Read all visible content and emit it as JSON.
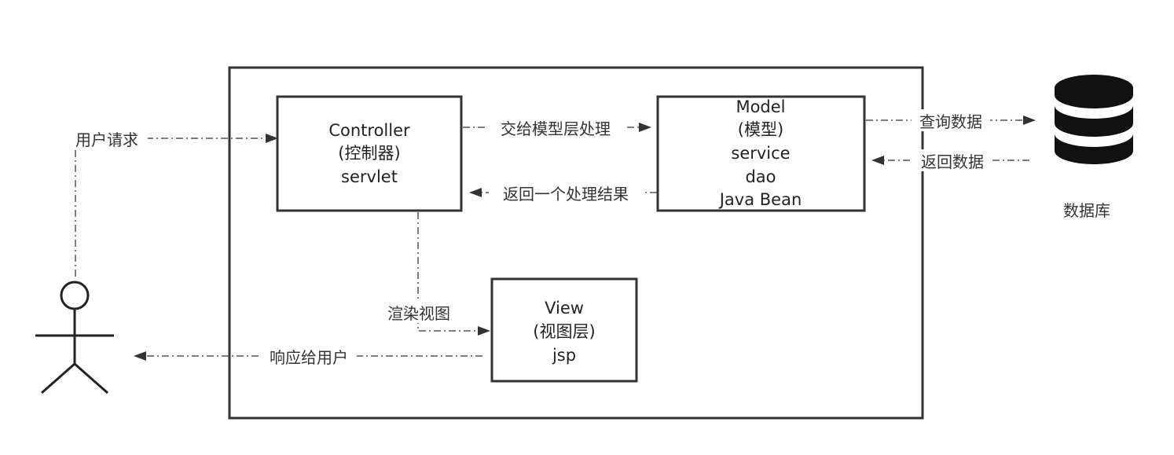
{
  "nodes": {
    "controller": {
      "lines": [
        "Controller",
        "(控制器)",
        "servlet"
      ]
    },
    "model": {
      "lines": [
        "Model",
        "(模型)",
        "service",
        "dao",
        "Java Bean"
      ]
    },
    "view": {
      "lines": [
        "View",
        "(视图层)",
        "jsp"
      ]
    },
    "database": {
      "label": "数据库"
    }
  },
  "edges": {
    "user_request": "用户请求",
    "to_model": "交给模型层处理",
    "return_result": "返回一个处理结果",
    "query_data": "查询数据",
    "return_data": "返回数据",
    "render_view": "渲染视图",
    "respond_user": "响应给用户"
  }
}
